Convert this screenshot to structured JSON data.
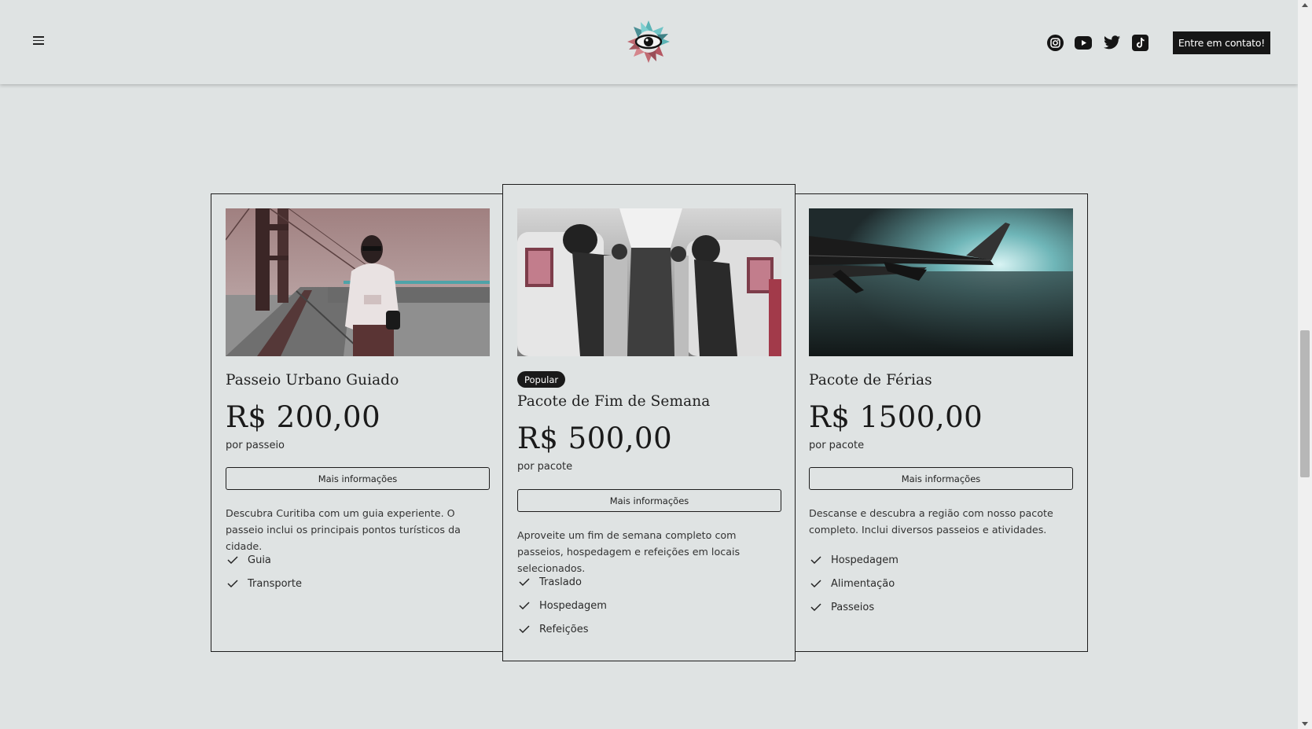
{
  "header": {
    "menu_icon": "hamburger-menu-icon",
    "logo_icon": "eye-logo-icon",
    "social": [
      {
        "name": "instagram",
        "icon": "instagram-icon"
      },
      {
        "name": "youtube",
        "icon": "youtube-icon"
      },
      {
        "name": "twitter",
        "icon": "twitter-icon"
      },
      {
        "name": "tiktok",
        "icon": "tiktok-icon"
      }
    ],
    "cta_label": "Entre em contato!"
  },
  "cards": [
    {
      "title": "Passeio Urbano Guiado",
      "price": "R$ 200,00",
      "unit": "por passeio",
      "button_label": "Mais informações",
      "description": "Descubra Curitiba com um guia experiente. O passeio inclui os principais pontos turísticos da cidade.",
      "features": [
        "Guia",
        "Transporte"
      ]
    },
    {
      "badge": "Popular",
      "title": "Pacote de Fim de Semana",
      "price": "R$ 500,00",
      "unit": "por pacote",
      "button_label": "Mais informações",
      "description": "Aproveite um fim de semana completo com passeios, hospedagem e refeições em locais selecionados.",
      "features": [
        "Traslado",
        "Hospedagem",
        "Refeições"
      ]
    },
    {
      "title": "Pacote de Férias",
      "price": "R$ 1500,00",
      "unit": "por pacote",
      "button_label": "Mais informações",
      "description": "Descanse e descubra a região com nosso pacote completo. Inclui diversos passeios e atividades.",
      "features": [
        "Hospedagem",
        "Alimentação",
        "Passeios"
      ]
    }
  ],
  "colors": {
    "background": "#dfe3e3",
    "text": "#1c1c1c",
    "button_dark": "#161616"
  }
}
